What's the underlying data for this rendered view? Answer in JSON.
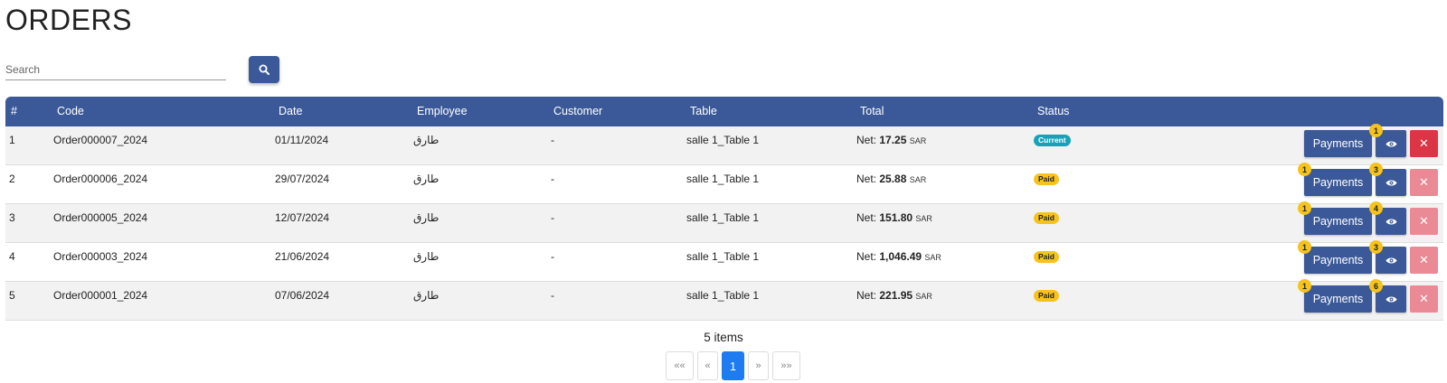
{
  "page": {
    "title": "ORDERS"
  },
  "search": {
    "placeholder": "Search",
    "value": ""
  },
  "table": {
    "headers": {
      "index": "#",
      "code": "Code",
      "date": "Date",
      "employee": "Employee",
      "customer": "Customer",
      "table": "Table",
      "total": "Total",
      "status": "Status"
    },
    "net_label": "Net:",
    "currency": "SAR",
    "payments_label": "Payments",
    "delete_symbol": "✕",
    "rows": [
      {
        "index": "1",
        "code": "Order000007_2024",
        "date": "01/11/2024",
        "employee": "طارق",
        "customer": "-",
        "table": "salle 1_Table 1",
        "total": "17.25",
        "status": "Current",
        "payments_count": "",
        "view_count": "1",
        "delete_enabled": true
      },
      {
        "index": "2",
        "code": "Order000006_2024",
        "date": "29/07/2024",
        "employee": "طارق",
        "customer": "-",
        "table": "salle 1_Table 1",
        "total": "25.88",
        "status": "Paid",
        "payments_count": "1",
        "view_count": "3",
        "delete_enabled": false
      },
      {
        "index": "3",
        "code": "Order000005_2024",
        "date": "12/07/2024",
        "employee": "طارق",
        "customer": "-",
        "table": "salle 1_Table 1",
        "total": "151.80",
        "status": "Paid",
        "payments_count": "1",
        "view_count": "4",
        "delete_enabled": false
      },
      {
        "index": "4",
        "code": "Order000003_2024",
        "date": "21/06/2024",
        "employee": "طارق",
        "customer": "-",
        "table": "salle 1_Table 1",
        "total": "1,046.49",
        "status": "Paid",
        "payments_count": "1",
        "view_count": "3",
        "delete_enabled": false
      },
      {
        "index": "5",
        "code": "Order000001_2024",
        "date": "07/06/2024",
        "employee": "طارق",
        "customer": "-",
        "table": "salle 1_Table 1",
        "total": "221.95",
        "status": "Paid",
        "payments_count": "1",
        "view_count": "6",
        "delete_enabled": false
      }
    ]
  },
  "pagination": {
    "items_label": "5 items",
    "first": "««",
    "prev": "«",
    "current": "1",
    "next": "»",
    "last": "»»"
  },
  "colors": {
    "primary": "#3b5998",
    "danger": "#dc3545",
    "danger_disabled": "#e98a94",
    "badge_current": "#17a2b8",
    "badge_paid": "#f5c31b",
    "page_active": "#1e7bf0"
  }
}
